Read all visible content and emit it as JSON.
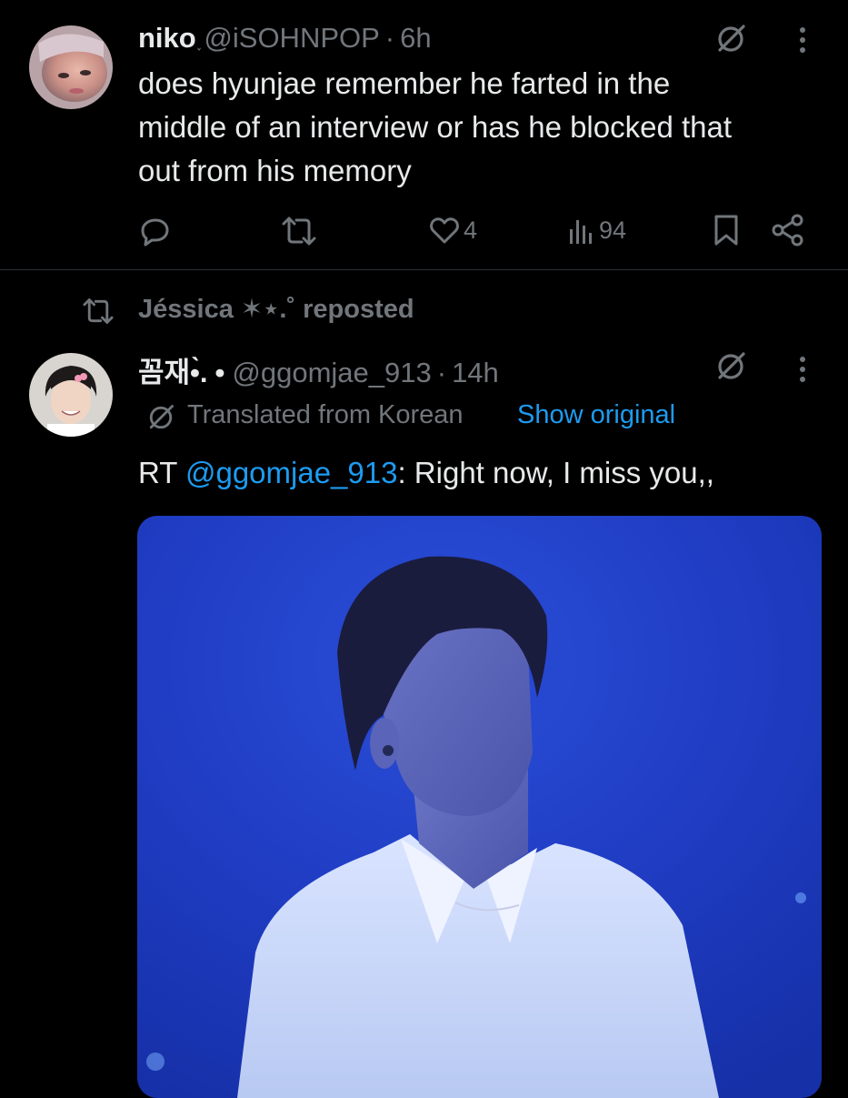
{
  "tweet1": {
    "display_name": "niko",
    "name_suffix": "˯",
    "handle": "@iSOHNPOP",
    "separator": "·",
    "time": "6h",
    "text_lines": [
      "does hyunjae remember he farted in the",
      "middle of an interview or has he blocked that",
      "out from his memory"
    ],
    "like_count": "4",
    "view_count": "94"
  },
  "repost_banner": {
    "text": "Jéssica ✶⋆.˚ reposted"
  },
  "tweet2": {
    "display_name": "꼼재•̀.",
    "badge": "•",
    "handle": "@ggomjae_913",
    "separator": "·",
    "time": "14h",
    "translated_label": "Translated from Korean",
    "show_original": "Show original",
    "text_prefix": "RT ",
    "text_mention": "@ggomjae_913",
    "text_rest": ": Right now, I miss you,,"
  },
  "colors": {
    "background": "#000000",
    "text": "#e7e9ea",
    "muted": "#71767b",
    "link": "#1d9bf0",
    "divider": "#2f3336"
  },
  "icons": [
    "grok-icon",
    "more-icon",
    "reply-icon",
    "retweet-icon",
    "heart-icon",
    "views-icon",
    "bookmark-icon",
    "share-icon",
    "translate-icon"
  ]
}
